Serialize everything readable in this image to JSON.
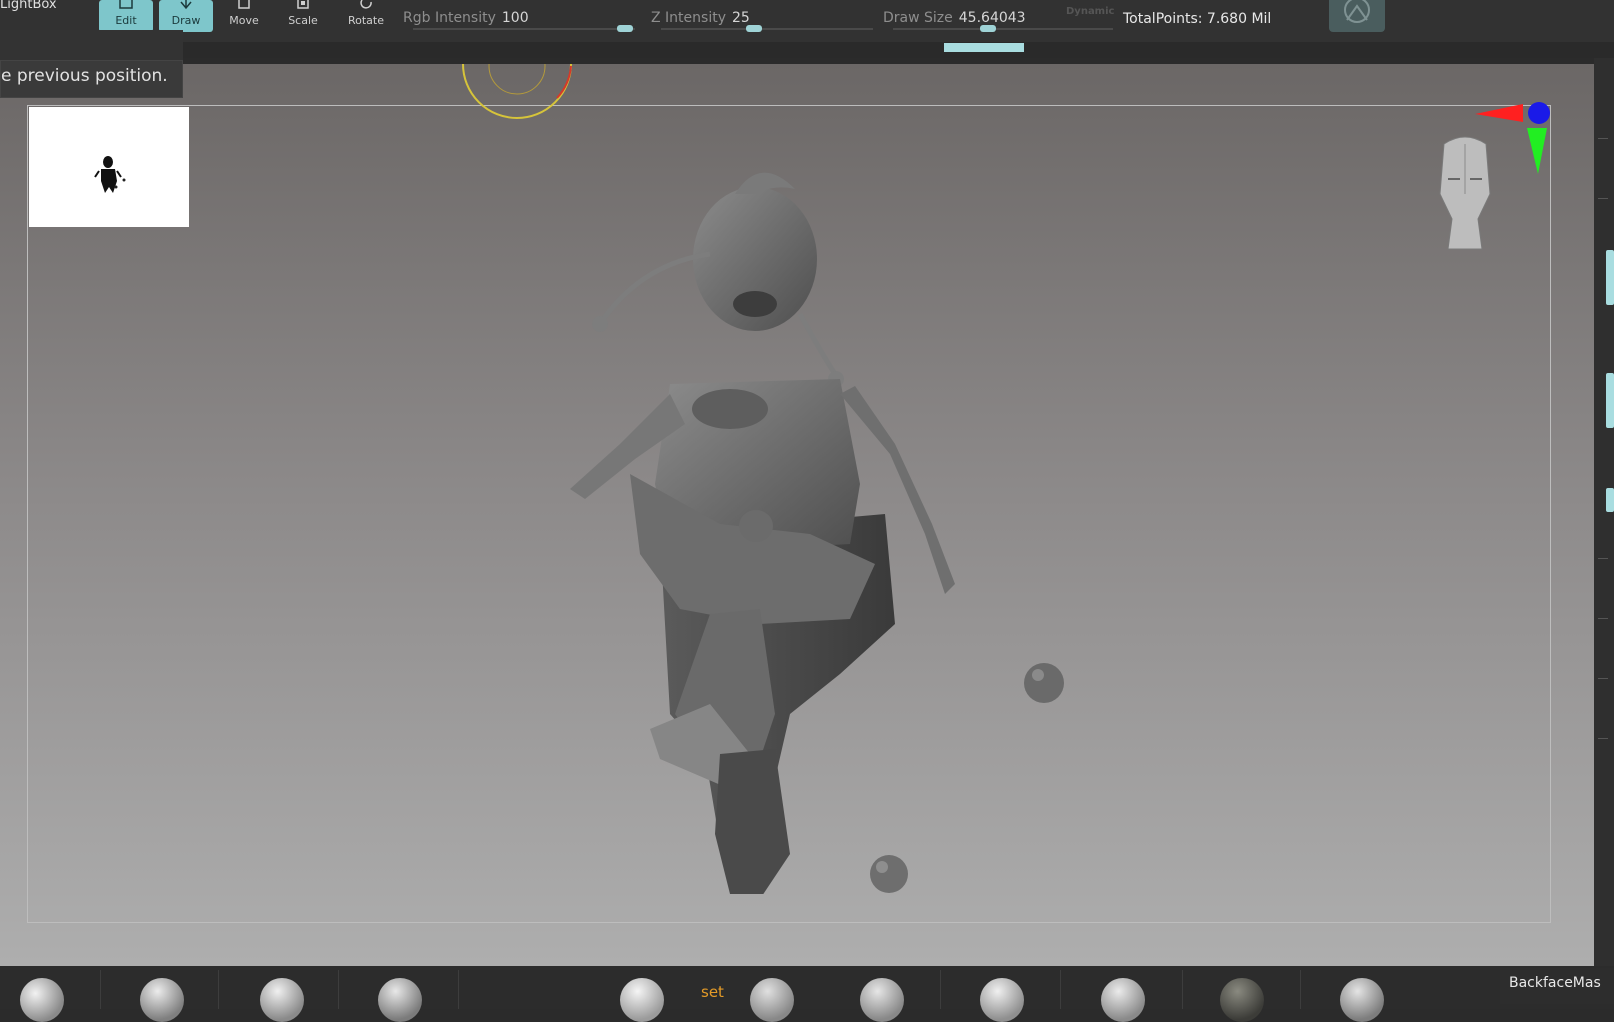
{
  "app": {
    "lightbox_label": "LightBox"
  },
  "toolbar": {
    "tools": [
      {
        "label": "Edit",
        "active": true,
        "icon": "edit-icon"
      },
      {
        "label": "Draw",
        "active": true,
        "icon": "draw-icon"
      },
      {
        "label": "Move",
        "active": false,
        "icon": "move-icon"
      },
      {
        "label": "Scale",
        "active": false,
        "icon": "scale-icon"
      },
      {
        "label": "Rotate",
        "active": false,
        "icon": "rotate-icon"
      }
    ],
    "sliders": [
      {
        "name": "Rgb Intensity",
        "value": "100",
        "level": 1.0
      },
      {
        "name": "Z Intensity",
        "value": "25",
        "level": 0.25
      },
      {
        "name": "Draw Size",
        "value": "45.64043",
        "level": 0.46
      }
    ],
    "dynamic_label": "Dynamic",
    "total_points": "TotalPoints: 7.680 Mil"
  },
  "tooltip": {
    "text": "e previous position."
  },
  "viewport": {
    "navigation_icons": [
      "axis-gizmo-icon",
      "head-orientation-icon",
      "navigation-circle-icon"
    ],
    "accent_colors": {
      "x_axis": "#ff2020",
      "y_axis": "#22ee22",
      "z_axis": "#1a1ae8",
      "ui_accent": "#9fd3d6"
    }
  },
  "bottom_shelf": {
    "status_text": "set",
    "backface_label": "BackfaceMas"
  }
}
